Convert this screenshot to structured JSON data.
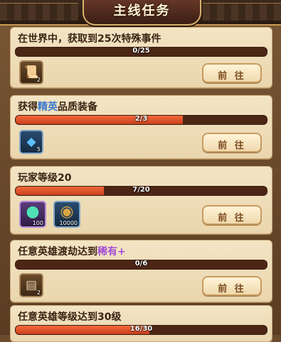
{
  "header": {
    "title": "主线任务"
  },
  "go_label": "前 往",
  "tasks": [
    {
      "title_parts": [
        "在世界中，获取到25次特殊事件",
        "",
        ""
      ],
      "progress_text": "0/25",
      "progress": 0.0,
      "rewards": [
        {
          "icon": "scroll-icon",
          "count": "2"
        }
      ]
    },
    {
      "title_parts": [
        "获得",
        "精英",
        "品质装备"
      ],
      "progress_text": "2/3",
      "progress": 0.667,
      "rewards": [
        {
          "icon": "blue-crystal-icon",
          "count": "5"
        }
      ]
    },
    {
      "title_parts": [
        "玩家等级20",
        "",
        ""
      ],
      "progress_text": "7/20",
      "progress": 0.35,
      "rewards": [
        {
          "icon": "jade-coin-icon",
          "count": "100"
        },
        {
          "icon": "copper-coin-icon",
          "count": "10000"
        }
      ]
    },
    {
      "title_parts": [
        "任意英雄渡劫达到",
        "稀有+",
        ""
      ],
      "progress_text": "0/6",
      "progress": 0.0,
      "rewards": [
        {
          "icon": "card-icon",
          "count": "2"
        }
      ]
    },
    {
      "title_parts": [
        "任意英雄等级达到30级",
        "",
        ""
      ],
      "progress_text": "16/30",
      "progress": 0.533,
      "rewards": []
    }
  ]
}
